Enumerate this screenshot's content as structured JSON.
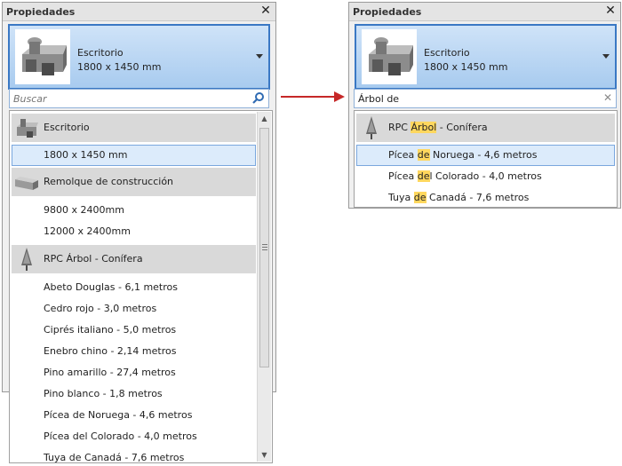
{
  "left_panel": {
    "title": "Propiedades",
    "close_label": "✕",
    "type_selector": {
      "name": "Escritorio",
      "size": "1800 x 1450 mm"
    },
    "search": {
      "placeholder": "Buscar",
      "value": ""
    },
    "list": [
      {
        "kind": "group",
        "icon": "desk-icon",
        "label": "Escritorio"
      },
      {
        "kind": "item",
        "label": "1800 x 1450 mm",
        "selected": true
      },
      {
        "kind": "group",
        "icon": "trailer-icon",
        "label": "Remolque de construcción"
      },
      {
        "kind": "item",
        "label": "9800 x 2400mm"
      },
      {
        "kind": "item",
        "label": "12000 x 2400mm"
      },
      {
        "kind": "group",
        "icon": "conifer-tree-icon",
        "label": "RPC Árbol - Conífera"
      },
      {
        "kind": "item",
        "label": "Abeto Douglas - 6,1 metros"
      },
      {
        "kind": "item",
        "label": "Cedro rojo - 3,0 metros"
      },
      {
        "kind": "item",
        "label": "Ciprés italiano - 5,0 metros"
      },
      {
        "kind": "item",
        "label": "Enebro chino - 2,14 metros"
      },
      {
        "kind": "item",
        "label": "Pino amarillo - 27,4 metros"
      },
      {
        "kind": "item",
        "label": "Pino blanco - 1,8 metros"
      },
      {
        "kind": "item",
        "label": "Pícea de Noruega - 4,6 metros"
      },
      {
        "kind": "item",
        "label": "Pícea del Colorado - 4,0 metros"
      },
      {
        "kind": "item",
        "label": "Tuya de Canadá - 7,6 metros"
      }
    ]
  },
  "right_panel": {
    "title": "Propiedades",
    "close_label": "✕",
    "type_selector": {
      "name": "Escritorio",
      "size": "1800 x 1450 mm"
    },
    "search": {
      "placeholder": "",
      "value": "Árbol de",
      "clear_label": "✕"
    },
    "list": [
      {
        "kind": "group",
        "icon": "conifer-tree-icon",
        "parts": [
          "RPC ",
          "Árbol",
          " - Conífera"
        ]
      },
      {
        "kind": "item",
        "selected": true,
        "parts": [
          "Pícea ",
          "de",
          " Noruega - 4,6 metros"
        ]
      },
      {
        "kind": "item",
        "parts": [
          "Pícea ",
          "de",
          "l Colorado - 4,0 metros"
        ]
      },
      {
        "kind": "item",
        "parts": [
          "Tuya ",
          "de",
          " Canadá - 7,6 metros"
        ]
      }
    ]
  },
  "colors": {
    "selection": "#dcebfb",
    "highlight": "#ffd75e",
    "arrow": "#c62828",
    "type_selector": "#a8cbef"
  }
}
